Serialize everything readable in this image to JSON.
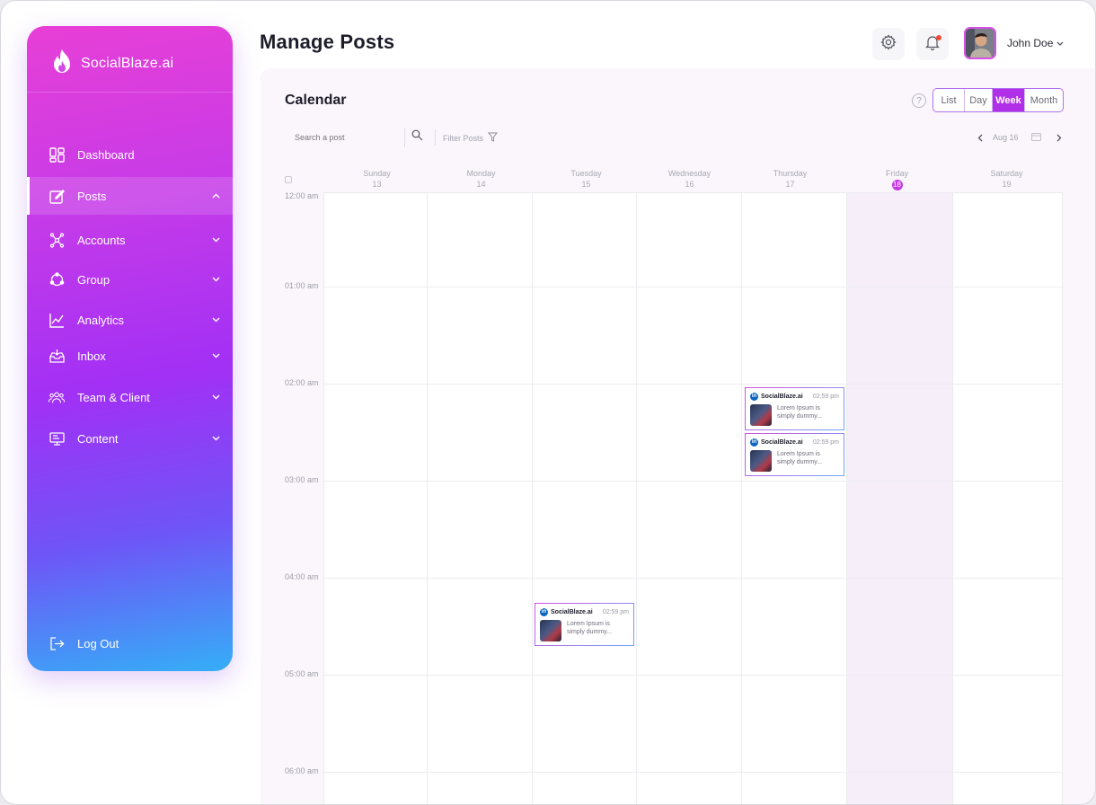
{
  "brand": {
    "name": "SocialBlaze.ai"
  },
  "sidebar": {
    "items": [
      {
        "label": "Dashboard",
        "icon": "dashboard-icon"
      },
      {
        "label": "Posts",
        "icon": "posts-icon",
        "active": true,
        "expanded": true
      },
      {
        "label": "Accounts",
        "icon": "accounts-icon"
      },
      {
        "label": "Group",
        "icon": "group-icon"
      },
      {
        "label": "Analytics",
        "icon": "analytics-icon"
      },
      {
        "label": "Inbox",
        "icon": "inbox-icon"
      },
      {
        "label": "Team & Client",
        "icon": "team-icon"
      },
      {
        "label": "Content",
        "icon": "content-icon"
      }
    ],
    "logout_label": "Log Out"
  },
  "header": {
    "title": "Manage Posts",
    "user_name": "John Doe",
    "has_notification": true
  },
  "calendar": {
    "title": "Calendar",
    "help": "?",
    "views": [
      "List",
      "Day",
      "Week",
      "Month"
    ],
    "active_view": "Week",
    "search_placeholder": "Search a post",
    "filter_label": "Filter Posts",
    "current_date": "Aug 16",
    "days": [
      {
        "name": "Sunday",
        "num": "13"
      },
      {
        "name": "Monday",
        "num": "14"
      },
      {
        "name": "Tuesday",
        "num": "15"
      },
      {
        "name": "Wednesday",
        "num": "16"
      },
      {
        "name": "Thursday",
        "num": "17"
      },
      {
        "name": "Friday",
        "num": "18",
        "today": true
      },
      {
        "name": "Saturday",
        "num": "19"
      }
    ],
    "times": [
      "12:00 am",
      "01:00 am",
      "02:00 am",
      "03:00 am",
      "04:00 am",
      "05:00 am",
      "06:00 am"
    ],
    "posts": [
      {
        "account": "SocialBlaze.ai",
        "time": "02:59 pm",
        "text": "Lorem Ipsum is simply dummy...",
        "network": "linkedin"
      },
      {
        "account": "SocialBlaze.ai",
        "time": "02:59 pm",
        "text": "Lorem Ipsum is simply dummy...",
        "network": "linkedin"
      },
      {
        "account": "SocialBlaze.ai",
        "time": "02:59 pm",
        "text": "Lorem Ipsum is simply dummy...",
        "network": "linkedin"
      }
    ]
  },
  "colors": {
    "accent": "#b12fe8",
    "sidebar_top": "#e83fd6",
    "sidebar_bottom": "#35aef7",
    "notification": "#f04a3a",
    "linkedin": "#0a66c2"
  }
}
